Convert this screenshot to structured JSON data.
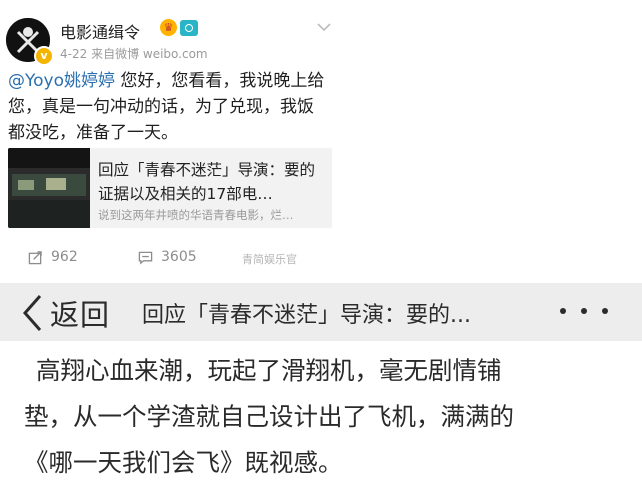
{
  "post": {
    "username": "电影通缉令",
    "badges": [
      "crown-badge",
      "camera-badge"
    ],
    "date": "4-22",
    "source": "来自微博 weibo.com",
    "mention": "@Yoyo姚婷婷",
    "text": " 您好，您看看，我说晚上给您，真是一句冲动的话，为了兑现，我饭都没吃，准备了一天。",
    "share": {
      "title": "回应「青春不迷茫」导演：要的证据以及相关的17部电…",
      "desc": "说到这两年井喷的华语青春电影，烂…"
    },
    "actions": {
      "repost_count": "962",
      "comment_count": "3605"
    },
    "watermark": "青简娱乐官"
  },
  "nav": {
    "back_label": "返回",
    "title": "回应「青春不迷茫」导演：要的..."
  },
  "article": {
    "lines": [
      "高翔心血来潮，玩起了滑翔机，毫无剧情铺",
      "垫，从一个学渣就自己设计出了飞机，满满的",
      "《哪一天我们会飞》既视感。"
    ]
  },
  "colors": {
    "mention": "#2a6fb0",
    "nav_bg": "#eeeded",
    "share_bg": "#f2f2f2",
    "muted": "#9a9a9a"
  }
}
